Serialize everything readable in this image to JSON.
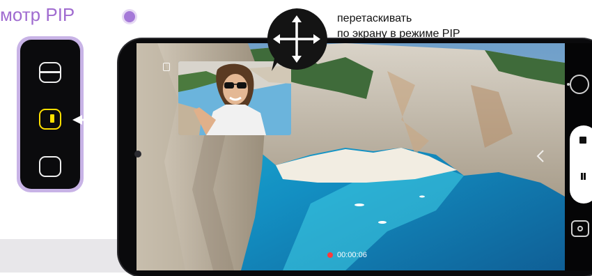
{
  "left_panel": {
    "title": "мотр PIP",
    "modes": [
      {
        "name": "split-view",
        "selected": false
      },
      {
        "name": "pip-view",
        "selected": true
      },
      {
        "name": "single-view",
        "selected": false
      }
    ]
  },
  "tooltip": {
    "lines": [
      "",
      "перетаскивать",
      "по экрану в режиме PIP"
    ]
  },
  "recording": {
    "time": "00:00:06"
  },
  "colors": {
    "accent_purple": "#a06cd0",
    "selected_mode": "#ffe000",
    "record_red": "#ff3b3b"
  },
  "icons": [
    "move-arrows-icon",
    "stop-icon",
    "pause-icon",
    "snapshot-icon",
    "flip-camera-icon",
    "chevron-left-icon"
  ]
}
